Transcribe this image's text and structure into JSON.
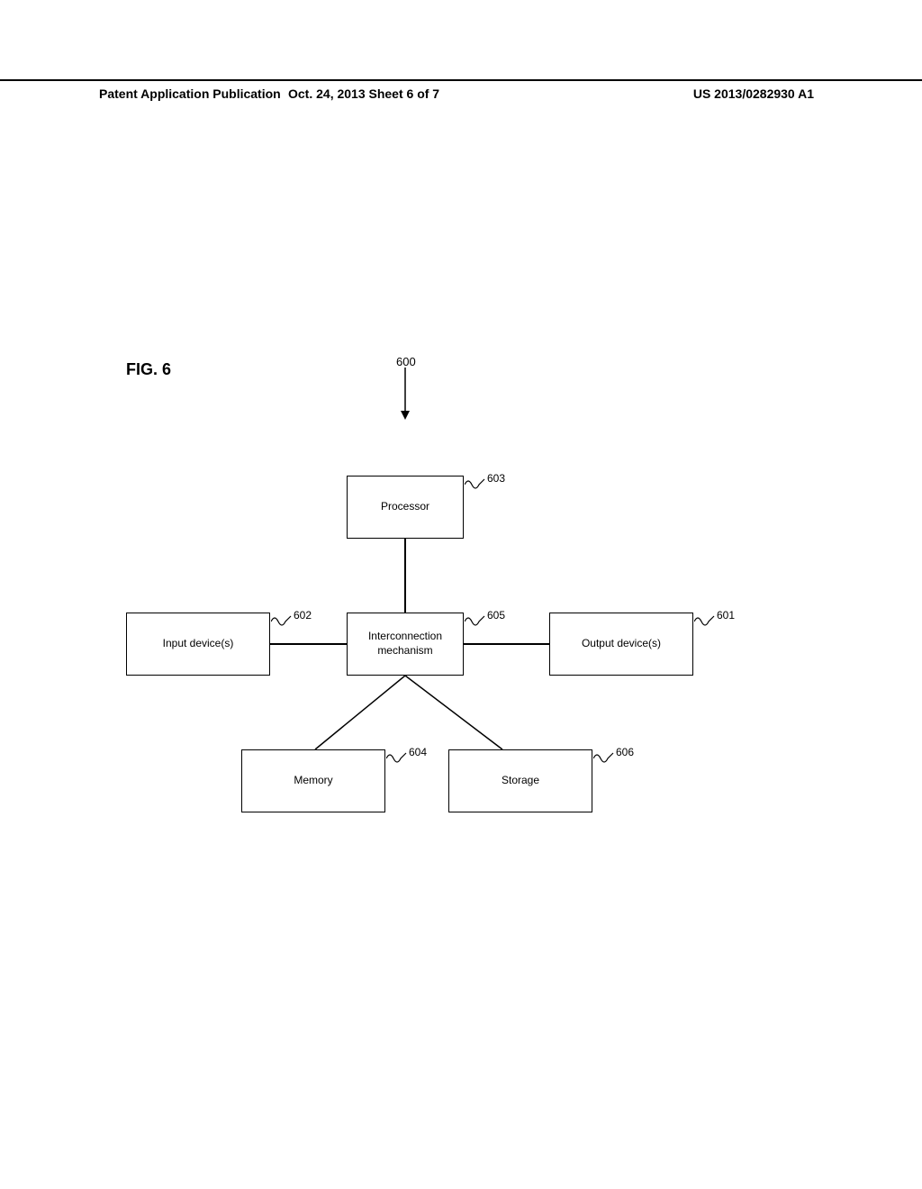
{
  "header": {
    "left": "Patent Application Publication",
    "center": "Oct. 24, 2013  Sheet 6 of 7",
    "right": "US 2013/0282930 A1"
  },
  "figure_label": "FIG. 6",
  "system_ref": "600",
  "blocks": {
    "processor": {
      "label": "Processor",
      "ref": "603"
    },
    "input": {
      "label": "Input device(s)",
      "ref": "602"
    },
    "interconnect": {
      "label": "Interconnection\nmechanism",
      "ref": "605"
    },
    "output": {
      "label": "Output device(s)",
      "ref": "601"
    },
    "memory": {
      "label": "Memory",
      "ref": "604"
    },
    "storage": {
      "label": "Storage",
      "ref": "606"
    }
  }
}
